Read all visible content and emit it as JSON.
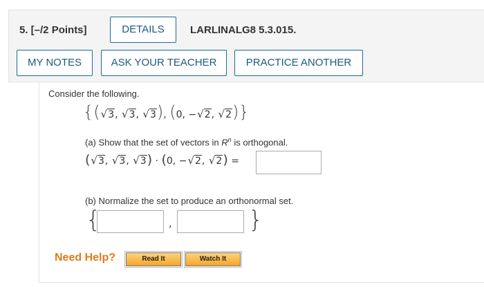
{
  "header": {
    "points": "5.  [–/2 Points]",
    "details_label": "DETAILS",
    "question_code": "LARLINALG8 5.3.015.",
    "my_notes_label": "MY NOTES",
    "ask_teacher_label": "ASK YOUR TEACHER",
    "practice_label": "PRACTICE ANOTHER"
  },
  "problem": {
    "intro": "Consider the following.",
    "v1": [
      "3",
      "3",
      "3"
    ],
    "v2_first": "0,",
    "v2_neg": "−",
    "v2_roots": [
      "2",
      "2"
    ],
    "part_a": "(a) Show that the set of vectors in",
    "part_a_space": "R",
    "part_a_exp": "n",
    "part_a_tail": "is orthogonal.",
    "dot": "·",
    "equals": "=",
    "part_b": "(b) Normalize the set to produce an orthonormal set.",
    "comma": ","
  },
  "help": {
    "label": "Need Help?",
    "read_label": "Read It",
    "watch_label": "Watch It"
  },
  "colors": {
    "button_border": "#1b6a93",
    "need_help": "#e07b1a",
    "help_button": "#f2a72c"
  }
}
